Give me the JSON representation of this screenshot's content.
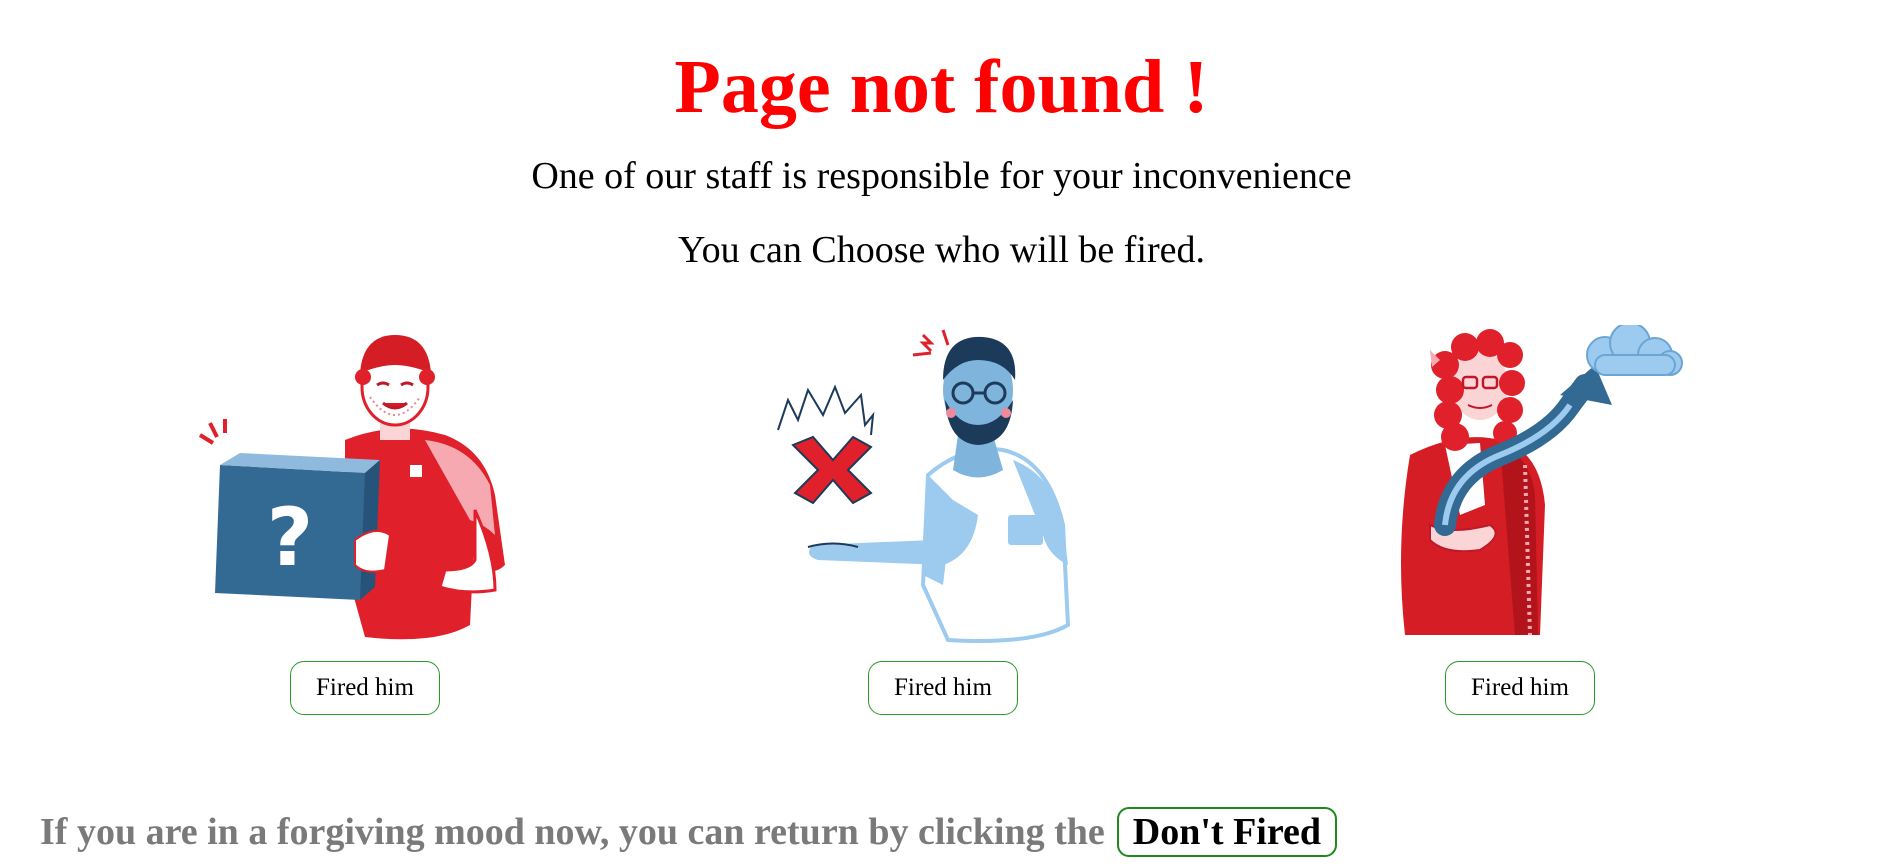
{
  "title": "Page not found !",
  "subtitle_line1": "One of our staff is responsible for your inconvenience",
  "subtitle_line2": "You can Choose who will be fired.",
  "staff": [
    {
      "button_label": "Fired him",
      "illustration": "delivery-man-with-question-box",
      "accent": "#e0202a"
    },
    {
      "button_label": "Fired him",
      "illustration": "angry-man-with-red-x",
      "accent": "#9ccbef"
    },
    {
      "button_label": "Fired him",
      "illustration": "curly-haired-man-with-arrow-and-cloud",
      "accent": "#d41d24"
    }
  ],
  "footer": {
    "text": "If you are in a forgiving mood now, you can return by clicking the",
    "button_label": "Don't Fired"
  },
  "colors": {
    "title": "#ff0000",
    "button_border": "#2a9a2a",
    "footer_text": "#7a7a7a",
    "navy": "#2f5f86",
    "light_blue": "#9ccbef"
  }
}
